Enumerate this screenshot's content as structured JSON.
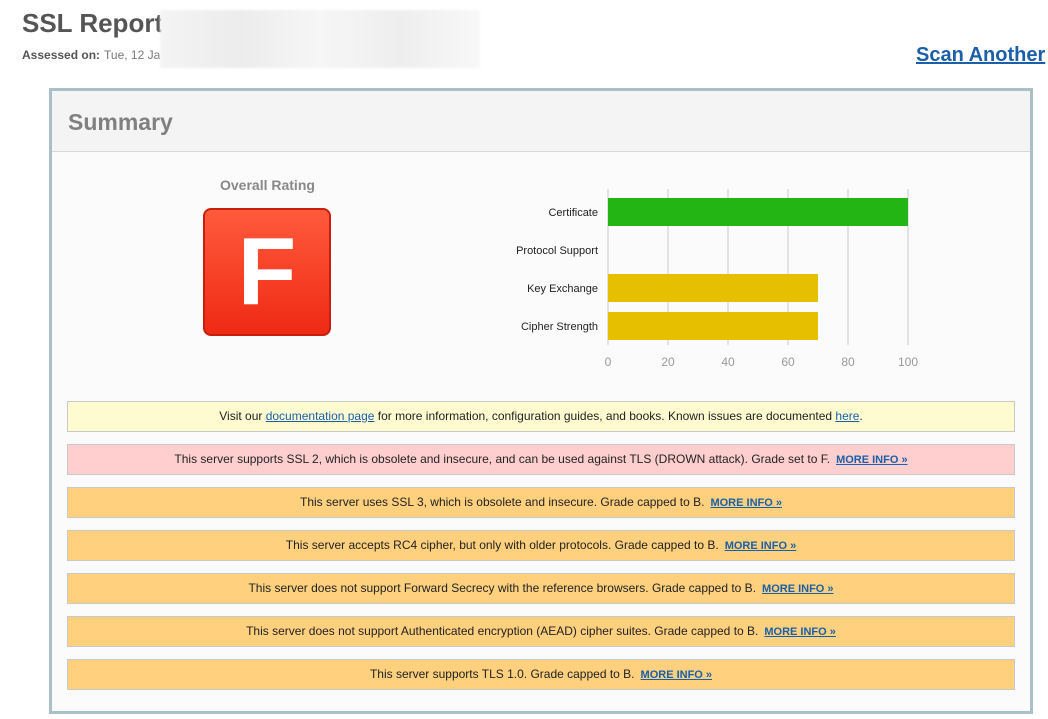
{
  "header": {
    "title": "SSL Report",
    "assessed_label": "Assessed on:",
    "assessed_value": "Tue, 12 Ja",
    "scan_another": "Scan Another"
  },
  "summary": {
    "title": "Summary",
    "overall_rating_label": "Overall Rating",
    "grade": "F",
    "grade_color": "#ef2a14"
  },
  "chart_data": {
    "type": "bar",
    "orientation": "horizontal",
    "categories": [
      "Certificate",
      "Protocol Support",
      "Key Exchange",
      "Cipher Strength"
    ],
    "values": [
      100,
      0,
      70,
      70
    ],
    "colors": [
      "#22b513",
      "#22b513",
      "#e6c000",
      "#e6c000"
    ],
    "xlim": [
      0,
      100
    ],
    "ticks": [
      "0",
      "20",
      "40",
      "60",
      "80",
      "100"
    ],
    "grid": true
  },
  "alerts": [
    {
      "type": "info",
      "before": "Visit our ",
      "link1": "documentation page",
      "middle": " for more information, configuration guides, and books. Known issues are documented ",
      "link2": "here",
      "after": "."
    },
    {
      "type": "danger",
      "text": "This server supports SSL 2, which is obsolete and insecure, and can be used against TLS (DROWN attack). Grade set to F.",
      "more": "MORE INFO »"
    },
    {
      "type": "warn",
      "text": "This server uses SSL 3, which is obsolete and insecure. Grade capped to B.",
      "more": "MORE INFO »"
    },
    {
      "type": "warn",
      "text": "This server accepts RC4 cipher, but only with older protocols. Grade capped to B.",
      "more": "MORE INFO »"
    },
    {
      "type": "warn",
      "text": "This server does not support Forward Secrecy with the reference browsers. Grade capped to B.",
      "more": "MORE INFO »"
    },
    {
      "type": "warn",
      "text": "This server does not support Authenticated encryption (AEAD) cipher suites. Grade capped to B.",
      "more": "MORE INFO »"
    },
    {
      "type": "warn",
      "text": "This server supports TLS 1.0. Grade capped to B.",
      "more": "MORE INFO »"
    }
  ]
}
